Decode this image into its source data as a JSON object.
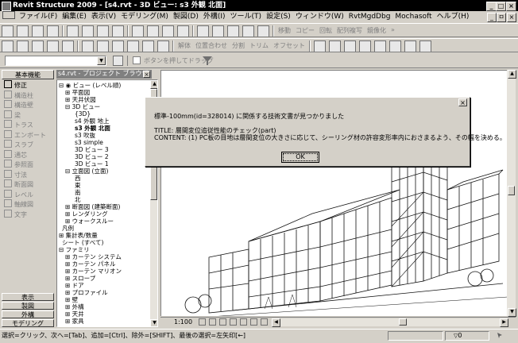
{
  "app": {
    "title": "Revit Structure 2009 - [s4.rvt - 3D ビュー: s3 外観 北面]"
  },
  "window_controls": {
    "minimize": "_",
    "restore": "□",
    "close": "×"
  },
  "doc_controls": {
    "minimize": "_",
    "restore": "ㅁ",
    "close": "×"
  },
  "menu": [
    "ファイル(F)",
    "編集(E)",
    "表示(V)",
    "モデリング(M)",
    "製図(D)",
    "外構(I)",
    "ツール(T)",
    "設定(S)",
    "ウィンドウ(W)",
    "RvtMgdDbg",
    "Mochasoft",
    "ヘルプ(H)"
  ],
  "toolbar1": {
    "help_label": "ヘルプ",
    "labels": [
      "移動",
      "コピー",
      "回転",
      "配列複写",
      "鏡像化"
    ],
    "more": "»"
  },
  "toolbar2": {
    "labels": [
      "解体",
      "位置合わせ",
      "分割",
      "トリム",
      "オフセット"
    ]
  },
  "toolbar3": {
    "drag_checkbox_label": "ボタンを押してドラッグ"
  },
  "palette": {
    "tab": "基本機能",
    "items": [
      "修正",
      "構造柱",
      "構造壁",
      "梁",
      "トラス",
      "エンボート",
      "スラブ",
      "通芯",
      "参照面",
      "寸法",
      "断面図",
      "レベル",
      "軸線図",
      "文字"
    ],
    "bottom_tabs": [
      "表示",
      "製図",
      "外構",
      "モデリング"
    ]
  },
  "browser": {
    "title": "s4.rvt - プロジェクト ブラウザ",
    "items": [
      {
        "t": "⊟ ◉ ビュー (レベル順)",
        "x": 2,
        "b": false
      },
      {
        "t": "⊞ 平面図",
        "x": 10,
        "b": false
      },
      {
        "t": "⊞ 天井伏図",
        "x": 10,
        "b": false
      },
      {
        "t": "⊟ 3D ビュー",
        "x": 10,
        "b": false
      },
      {
        "t": "{3D}",
        "x": 22,
        "b": false
      },
      {
        "t": "s4 外観 地上",
        "x": 22,
        "b": false
      },
      {
        "t": "s3 外観 北面",
        "x": 22,
        "b": true
      },
      {
        "t": "s3 吹抜",
        "x": 22,
        "b": false
      },
      {
        "t": "s3 simple",
        "x": 22,
        "b": false
      },
      {
        "t": "3D ビュー 3",
        "x": 22,
        "b": false
      },
      {
        "t": "3D ビュー 2",
        "x": 22,
        "b": false
      },
      {
        "t": "3D ビュー 1",
        "x": 22,
        "b": false
      },
      {
        "t": "⊟ 立面図 (立面)",
        "x": 10,
        "b": false
      },
      {
        "t": "西",
        "x": 22,
        "b": false
      },
      {
        "t": "東",
        "x": 22,
        "b": false
      },
      {
        "t": "南",
        "x": 22,
        "b": false
      },
      {
        "t": "北",
        "x": 22,
        "b": false
      },
      {
        "t": "⊞ 断面図 (建築断面)",
        "x": 10,
        "b": false
      },
      {
        "t": "⊞ レンダリング",
        "x": 10,
        "b": false
      },
      {
        "t": "⊞ ウォークスルー",
        "x": 10,
        "b": false
      },
      {
        "t": "凡例",
        "x": 6,
        "b": false
      },
      {
        "t": "⊞ 集計表/数量",
        "x": 2,
        "b": false
      },
      {
        "t": "シート (すべて)",
        "x": 6,
        "b": false
      },
      {
        "t": "⊟ ファミリ",
        "x": 2,
        "b": false
      },
      {
        "t": "⊞ カーテン システム",
        "x": 10,
        "b": false
      },
      {
        "t": "⊞ カーテン パネル",
        "x": 10,
        "b": false
      },
      {
        "t": "⊞ カーテン マリオン",
        "x": 10,
        "b": false
      },
      {
        "t": "⊞ スロープ",
        "x": 10,
        "b": false
      },
      {
        "t": "⊞ ドア",
        "x": 10,
        "b": false
      },
      {
        "t": "⊞ プロファイル",
        "x": 10,
        "b": false
      },
      {
        "t": "⊞ 壁",
        "x": 10,
        "b": false
      },
      {
        "t": "⊞ 外構",
        "x": 10,
        "b": false
      },
      {
        "t": "⊞ 天井",
        "x": 10,
        "b": false
      },
      {
        "t": "⊞ 家具",
        "x": 10,
        "b": false
      }
    ]
  },
  "dialog": {
    "close": "×",
    "line1": "標準-100mm(id=328014) に関係する技術文書が見つかりました",
    "line2": "TITLE: 層間変位追従性能のチェック(part)",
    "line3": "CONTENT: (1) PC板の目地は層間変位の大きさに応じて、シーリング材の許容変形率内におさまるよう、その幅を決める。",
    "ok": "OK"
  },
  "viewbar": {
    "scale": "1:100"
  },
  "status": {
    "text": "選択=クリック、次へ=[Tab]、追加=[Ctrl]、除外=[SHIFT]、最後の選択=左矢印[←]",
    "count": "0"
  }
}
